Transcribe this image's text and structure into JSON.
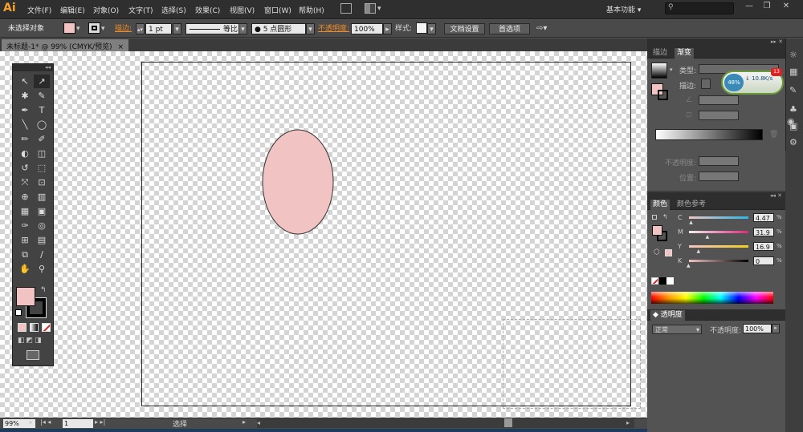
{
  "app": {
    "logo": "Ai",
    "menu": [
      "文件(F)",
      "编辑(E)",
      "对象(O)",
      "文字(T)",
      "选择(S)",
      "效果(C)",
      "视图(V)",
      "窗口(W)",
      "帮助(H)"
    ],
    "workspace": "基本功能",
    "workspace_arrow": "▾",
    "window_min": "—",
    "window_max": "❐",
    "window_close": "✕"
  },
  "control_bar": {
    "selection_status": "未选择对象",
    "stroke_label": "描边:",
    "stroke_weight": "1 pt",
    "stroke_profile": "等比",
    "brush_label": "5 点圆形",
    "opacity_label": "不透明度:",
    "opacity_value": "100%",
    "style_label": "样式:",
    "doc_settings_button": "文档设置",
    "preferences_button": "首选项",
    "fill_color": "#f2c3c3"
  },
  "document": {
    "tab_title": "未标题-1* @ 99% (CMYK/预览)",
    "tab_close": "×"
  },
  "canvas": {
    "ellipse_fill": "#f2c3c3",
    "ellipse_stroke": "#333333"
  },
  "toolbox": {
    "tools": [
      "↖",
      "↗",
      "✱",
      "✎",
      "✒",
      "T",
      "╲",
      "◯",
      "✏",
      "✐",
      "◐",
      "◫",
      "↺",
      "⬚",
      "⤧",
      "⊡",
      "⊕",
      "▥",
      "▦",
      "▣",
      "✑",
      "◎",
      "⊞",
      "▤",
      "⧉",
      "∕",
      "✋",
      "⚲"
    ],
    "fill_color": "#f2c3c3",
    "stroke_color": "#000000"
  },
  "status_bar": {
    "zoom": "99%",
    "page": "1",
    "status_text": "选择"
  },
  "gradient_panel": {
    "tab_stroke": "描边",
    "tab_gradient": "渐变",
    "type_label": "类型:",
    "stroke_label": "描边:",
    "opacity_label": "不透明度:",
    "position_label": "位置:"
  },
  "net_widget": {
    "percent": "48%",
    "speed": "10.8K/s",
    "badge": "13"
  },
  "color_panel": {
    "tab_color": "颜色",
    "tab_color_guide": "颜色参考",
    "channels": [
      {
        "label": "C",
        "value": "4.47",
        "unit": "%",
        "level": 0.0447
      },
      {
        "label": "M",
        "value": "31.9",
        "unit": "%",
        "level": 0.319
      },
      {
        "label": "Y",
        "value": "16.9",
        "unit": "%",
        "level": 0.169
      },
      {
        "label": "K",
        "value": "0",
        "unit": "%",
        "level": 0.0
      }
    ],
    "swatch_color": "#f2c3c3"
  },
  "transparency_panel": {
    "tab": "透明度",
    "blend_mode": "正常",
    "opacity_label": "不透明度:",
    "opacity_value": "100%"
  }
}
